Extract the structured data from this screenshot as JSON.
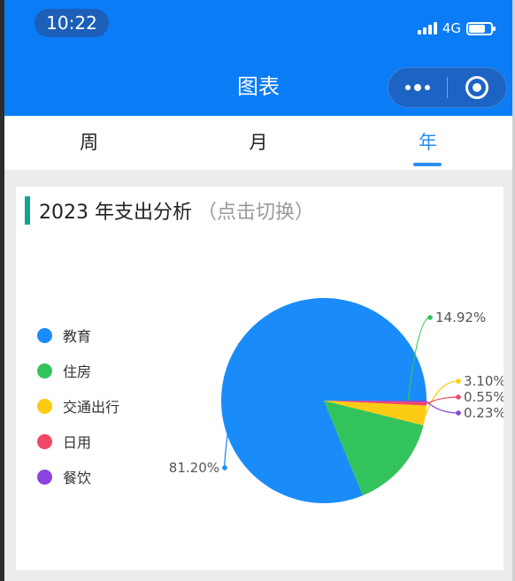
{
  "status_bar": {
    "time": "10:22",
    "network": "4G"
  },
  "nav": {
    "title": "图表",
    "more_icon": "more-dots-icon",
    "close_icon": "target-icon"
  },
  "tabs": [
    {
      "label": "周",
      "active": false
    },
    {
      "label": "月",
      "active": false
    },
    {
      "label": "年",
      "active": true
    }
  ],
  "card": {
    "title": "2023 年支出分析",
    "hint": "（点击切换）"
  },
  "chart_data": {
    "type": "pie",
    "title": "2023 年支出分析",
    "legend_position": "left",
    "series": [
      {
        "name": "教育",
        "value": 81.2,
        "label": "81.20%",
        "color": "#1a8cf9"
      },
      {
        "name": "住房",
        "value": 14.92,
        "label": "14.92%",
        "color": "#33c35c"
      },
      {
        "name": "交通出行",
        "value": 3.1,
        "label": "3.10%",
        "color": "#fccc14"
      },
      {
        "name": "日用",
        "value": 0.55,
        "label": "0.55%",
        "color": "#f04864"
      },
      {
        "name": "餐饮",
        "value": 0.23,
        "label": "0.23%",
        "color": "#8c43e0"
      }
    ]
  }
}
